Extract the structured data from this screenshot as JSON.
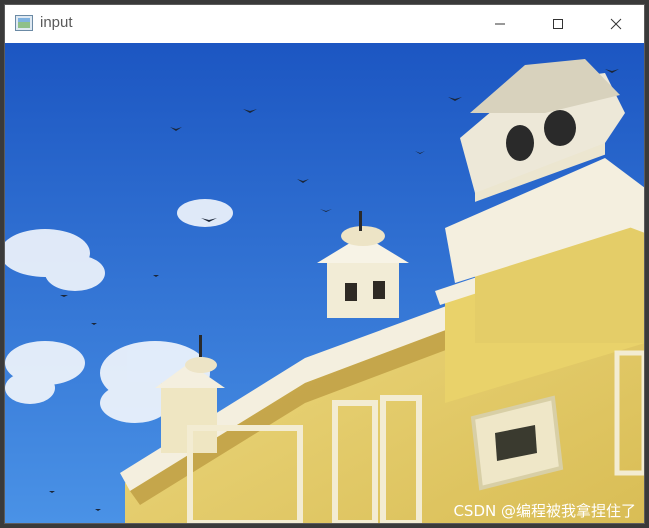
{
  "window": {
    "title": "input",
    "app_icon": "image-window-icon",
    "controls": {
      "minimize_icon": "minimize-icon",
      "maximize_icon": "maximize-icon",
      "close_icon": "close-icon"
    }
  },
  "image": {
    "subject": "Palace building with towers against blue sky and flying birds",
    "watermark": "CSDN @编程被我拿捏住了"
  },
  "colors": {
    "sky_top": "#1f5fc8",
    "sky_bottom": "#3d86e0",
    "building": "#e6cf6a",
    "building_shadow": "#c4a84a",
    "white_trim": "#f2f0e6"
  }
}
